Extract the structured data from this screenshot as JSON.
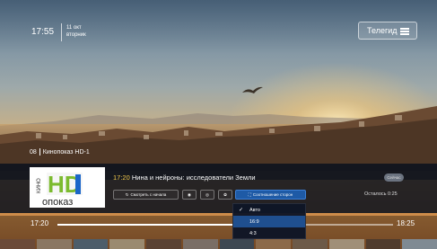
{
  "header": {
    "time": "17:55",
    "date_line1": "11 окт",
    "date_line2": "вторник",
    "guide_label": "Телегид",
    "menu_icon": "menu-icon"
  },
  "channel": {
    "number": "08",
    "name": "Кинопоказ HD-1",
    "logo_text_top": "КИНО",
    "logo_text_hd": "HD",
    "logo_text_bottom": "опоказ"
  },
  "program": {
    "start_time": "17:20",
    "title": "Нина и нейроны: исследователи Земли",
    "live_badge": "Сейчас",
    "remaining": "Осталось 0:25",
    "progress_fraction": 0.7
  },
  "actions": {
    "watch_from_start": "Смотреть с начала",
    "aspect_ratio": "Соотношение сторон"
  },
  "aspect_menu": {
    "options": [
      "Авто",
      "16:9",
      "4:3"
    ],
    "selected_index": 1
  },
  "timeline": {
    "start": "17:20",
    "end": "18:25"
  },
  "colors": {
    "accent_time": "#f2c94c",
    "active_button": "#1e5aa6",
    "logo_green": "#7cbb2f",
    "logo_blue": "#1b66c9"
  }
}
